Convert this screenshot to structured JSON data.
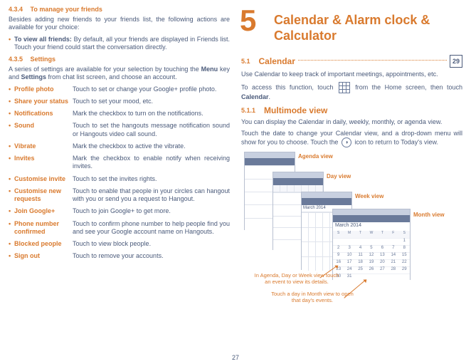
{
  "page_number": "27",
  "left": {
    "sec434": {
      "num": "4.3.4",
      "title": "To manage your friends"
    },
    "intro434": "Besides adding new friends to your friends list, the following actions are available for your choice:",
    "bullet434_label": "To view all friends:",
    "bullet434_text": " By default, all your friends are displayed in Friends list. Touch your friend could start the conversation directly.",
    "sec435": {
      "num": "4.3.5",
      "title": "Settings"
    },
    "intro435a": "A series of settings are available for your selection by touching the ",
    "intro435_menu": "Menu",
    "intro435b": " key and ",
    "intro435_settings": "Settings",
    "intro435c": " from chat list screen, and choose an account.",
    "settings": [
      {
        "label": "Profile photo",
        "desc": "Touch to set or change your Google+ profile photo."
      },
      {
        "label": "Share your status",
        "desc": "Touch to set your mood, etc."
      },
      {
        "label": "Notifications",
        "desc": "Mark the checkbox to turn on the notifications."
      },
      {
        "label": "Sound",
        "desc": "Touch to set the hangouts message notification sound or Hangouts video call sound."
      },
      {
        "label": "Vibrate",
        "desc": "Mark the checkbox to active the vibrate."
      },
      {
        "label": "Invites",
        "desc": "Mark the checkbox to enable notify when receiving invites."
      },
      {
        "label": "Customise invite",
        "desc": "Touch to set the invites rights."
      },
      {
        "label": "Customise new requests",
        "desc": "Touch to enable that people in your circles can hangout with you or send you a request to Hangout."
      },
      {
        "label": "Join Google+",
        "desc": "Touch to join Google+  to get  more."
      },
      {
        "label": "Phone number confirmed",
        "desc": "Touch to confirm phone number to help people find you and see your Google account name on Hangouts."
      },
      {
        "label": "Blocked people",
        "desc": "Touch to view block people."
      },
      {
        "label": "Sign out",
        "desc": "Touch to remove your accounts."
      }
    ]
  },
  "right": {
    "big_num": "5",
    "chapter": "Calendar & Alarm clock & Calculator",
    "sec51": {
      "num": "5.1",
      "title": "Calendar"
    },
    "cal_icon_text": "29",
    "p51_intro": "Use Calendar to keep track of important meetings, appointments, etc.",
    "p51_access_a": "To access this function, touch ",
    "p51_access_b": " from the Home screen, then touch ",
    "p51_access_c": "Calendar",
    "p51_access_d": ".",
    "sec511": {
      "num": "5.1.1",
      "title": "Multimode view"
    },
    "p511_a": "You can display the Calendar in daily, weekly, monthly, or agenda view.",
    "p511_b_a": "Touch the date to change your Calendar view, and a drop-down menu will show for you to choose. Touch the ",
    "p511_b_b": " icon to return to Today's view.",
    "view_labels": {
      "agenda": "Agenda view",
      "day": "Day view",
      "week": "Week view",
      "month": "Month view"
    },
    "month_header": "March 2014",
    "day_headers": [
      "S",
      "M",
      "T",
      "W",
      "T",
      "F",
      "S"
    ],
    "caption1": "In Agenda, Day or Week view touch an event to view its details.",
    "caption2": "Touch a day in Month view to open that day's events."
  }
}
